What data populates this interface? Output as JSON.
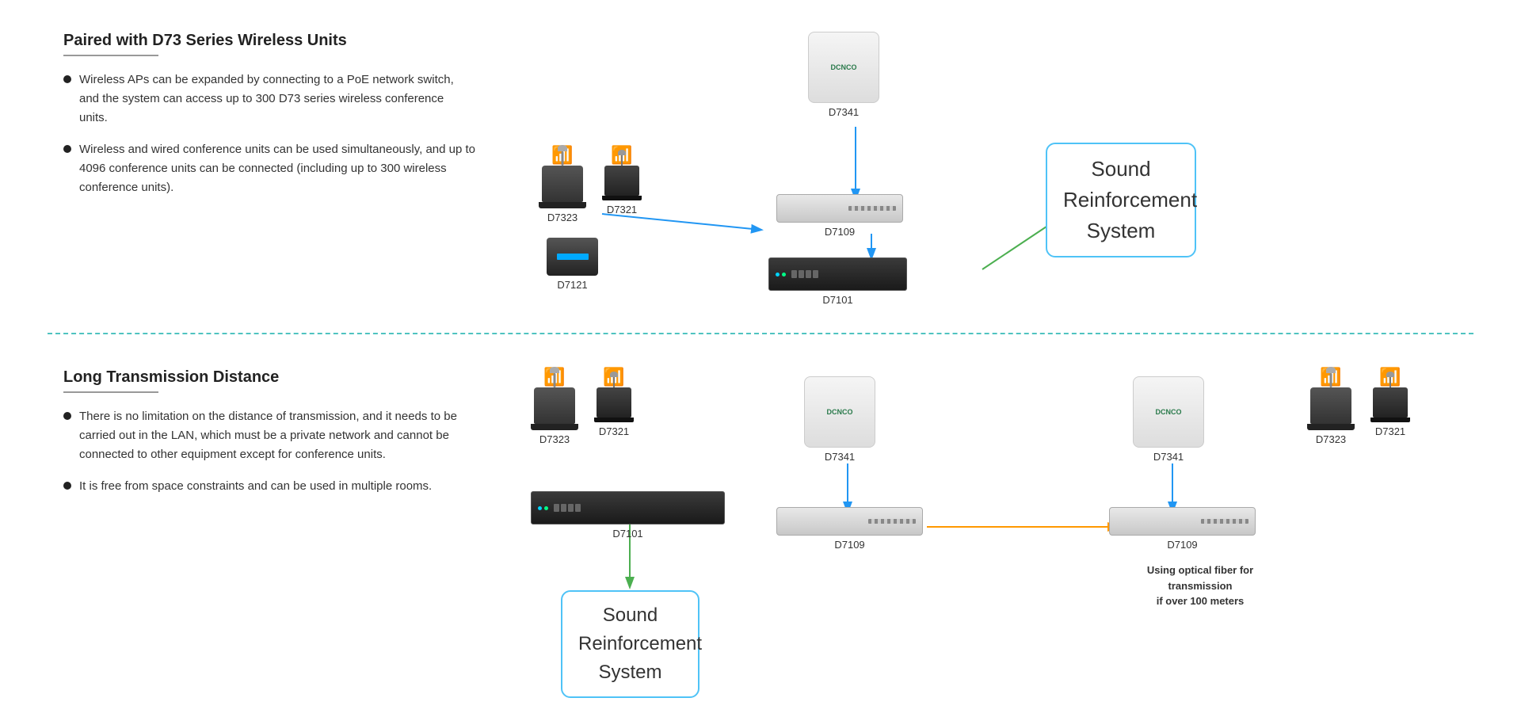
{
  "top": {
    "title": "Paired with D73 Series Wireless Units",
    "bullets": [
      "Wireless APs can be expanded by connecting to a PoE network switch, and the system can access up to 300 D73 series wireless conference units.",
      "Wireless and wired conference units can be used simultaneously, and up to 4096 conference units can be connected (including up to 300 wireless conference units)."
    ]
  },
  "bottom": {
    "title": "Long Transmission Distance",
    "bullets": [
      "There is no limitation on the distance of transmission, and it needs to be carried out in the LAN, which must be a private network and cannot be connected to other equipment except for conference units.",
      "It is free from space constraints and can be used in multiple rooms."
    ]
  },
  "devices": {
    "d7323": "D7323",
    "d7321": "D7321",
    "d7341": "D7341",
    "d7109": "D7109",
    "d7101": "D7101",
    "d7121": "D7121"
  },
  "sound_box": {
    "text": "Sound\nReinforcement\nSystem"
  },
  "fiber_note": "Using optical fiber for transmission\nif over 100 meters",
  "ap_logo": "DCNCO"
}
